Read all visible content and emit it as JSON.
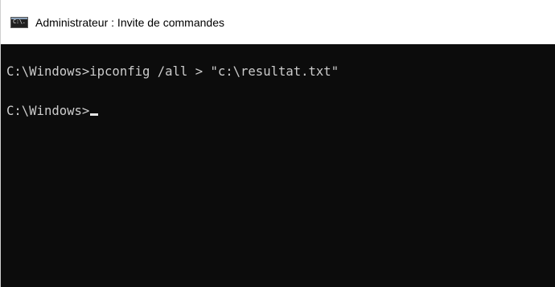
{
  "window": {
    "title": "Administrateur : Invite de commandes",
    "icon": "cmd-console-icon",
    "icon_text": "C:\\."
  },
  "console": {
    "lines": [
      "C:\\Windows>ipconfig /all > \"c:\\resultat.txt\"",
      "C:\\Windows>"
    ],
    "cursor": "blinking-underscore"
  },
  "colors": {
    "console_background": "#0c0c0c",
    "console_text": "#cccccc",
    "titlebar_background": "#ffffff"
  }
}
